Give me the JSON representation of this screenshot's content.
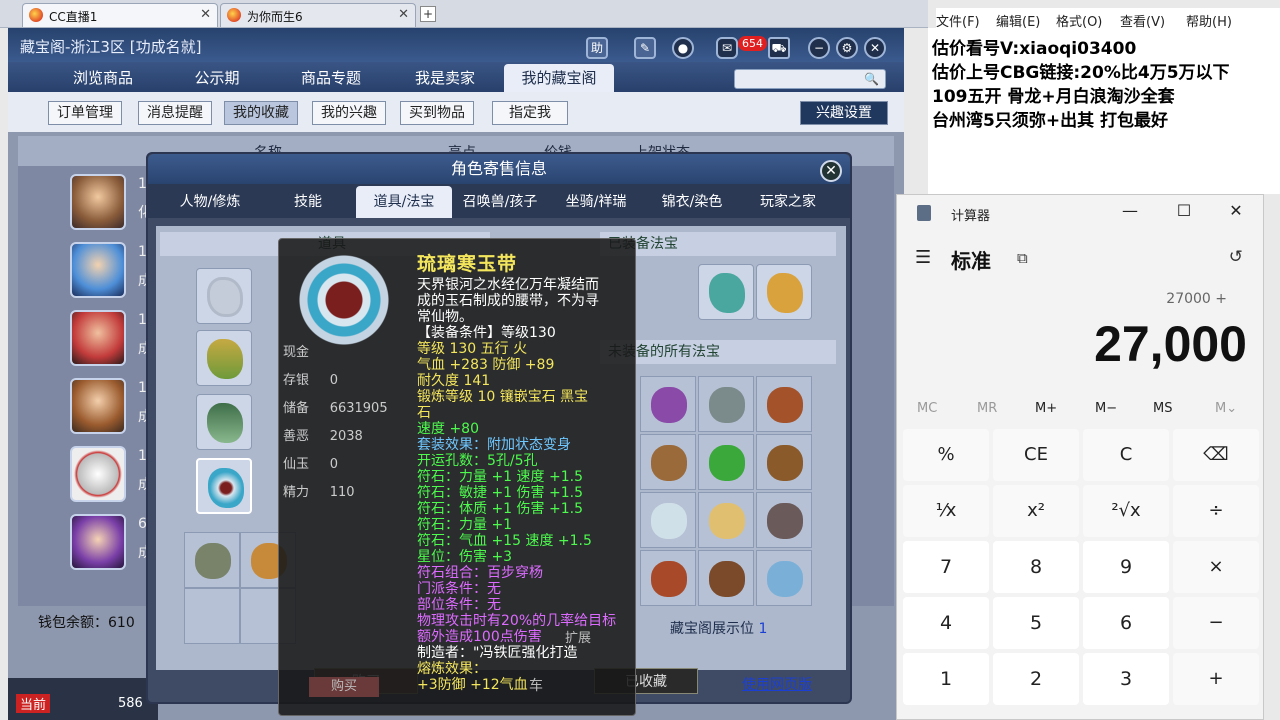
{
  "browser": {
    "tabs": [
      {
        "label": "CC直播1"
      },
      {
        "label": "为你而生6"
      }
    ],
    "new_tab": "+"
  },
  "game": {
    "title": "藏宝阁-浙江3区 [功成名就]",
    "title_buttons": {
      "help": "助",
      "badge": "654"
    },
    "nav_tabs": [
      "浏览商品",
      "公示期",
      "商品专题",
      "我是卖家",
      "我的藏宝阁"
    ],
    "active_nav": "我的藏宝阁",
    "subnav": [
      "订单管理",
      "消息提醒",
      "我的收藏",
      "我的兴趣",
      "买到物品",
      "指定我"
    ],
    "active_subnav": "我的收藏",
    "interest_settings": "兴趣设置",
    "list_headers": {
      "name": "名称",
      "price": "价钱",
      "status": "上架状态",
      "bright": "亮点"
    },
    "rows": [
      {
        "lvl": "17",
        "sub": "化"
      },
      {
        "lvl": "10",
        "sub": "成"
      },
      {
        "lvl": "13",
        "sub": "成"
      },
      {
        "lvl": "10",
        "sub": "成"
      },
      {
        "lvl": "13",
        "sub": "成"
      },
      {
        "lvl": "69",
        "sub": "成"
      }
    ],
    "wallet": "钱包余额：610",
    "current": "当前",
    "counter": "586"
  },
  "modal": {
    "title": "角色寄售信息",
    "tabs": [
      "人物/修炼",
      "技能",
      "道具/法宝",
      "召唤兽/孩子",
      "坐骑/祥瑞",
      "锦衣/染色",
      "玩家之家"
    ],
    "active_tab": "道具/法宝",
    "section_items": "道具",
    "section_equipped": "已装备法宝",
    "section_unequipped": "未装备的所有法宝",
    "stats": [
      {
        "label": "现金",
        "value": ""
      },
      {
        "label": "存银",
        "value": "0"
      },
      {
        "label": "储备",
        "value": "6631905"
      },
      {
        "label": "善恶",
        "value": "2038"
      },
      {
        "label": "仙玉",
        "value": "0"
      },
      {
        "label": "精力",
        "value": "110"
      }
    ],
    "showcase": "藏宝阁展示位",
    "showcase_count": "1",
    "buy": "购买",
    "cart": "车",
    "collected": "已收藏",
    "web_version": "使用网页版",
    "expand": "扩展"
  },
  "tooltip": {
    "title": "琉璃寒玉带",
    "lines": [
      {
        "text": "天界银河之水经亿万年凝结而",
        "c": "tw"
      },
      {
        "text": "成的玉石制成的腰带，不为寻",
        "c": "tw"
      },
      {
        "text": "常仙物。",
        "c": "tw"
      },
      {
        "text": "【装备条件】等级130",
        "c": "tw"
      },
      {
        "text": "等级 130  五行 火",
        "c": "ty"
      },
      {
        "text": "气血 +283 防御 +89",
        "c": "ty"
      },
      {
        "text": "耐久度 141",
        "c": "ty"
      },
      {
        "text": "锻炼等级 10  镶嵌宝石 黑宝",
        "c": "ty"
      },
      {
        "text": "石",
        "c": "ty"
      },
      {
        "text": "速度 +80",
        "c": "tg"
      },
      {
        "text": "套装效果：附加状态变身",
        "c": "tb"
      },
      {
        "text": "开运孔数：5孔/5孔",
        "c": "tg"
      },
      {
        "text": "符石：力量 +1  速度 +1.5",
        "c": "tg"
      },
      {
        "text": "符石：敏捷 +1  伤害 +1.5",
        "c": "tg"
      },
      {
        "text": "符石：体质 +1  伤害 +1.5",
        "c": "tg"
      },
      {
        "text": "符石：力量 +1",
        "c": "tg"
      },
      {
        "text": "符石：气血 +15  速度 +1.5",
        "c": "tg"
      },
      {
        "text": "星位：伤害 +3",
        "c": "tg"
      },
      {
        "text": "符石组合：百步穿杨",
        "c": "tp"
      },
      {
        "text": "门派条件：无",
        "c": "tp"
      },
      {
        "text": "部位条件：无",
        "c": "tp"
      },
      {
        "text": "物理攻击时有20%的几率给目标",
        "c": "tp"
      },
      {
        "text": "额外造成100点伤害",
        "c": "tp"
      },
      {
        "text": "制造者：\"冯铁匠强化打造",
        "c": "tw"
      },
      {
        "text": "熔炼效果：",
        "c": "ty"
      },
      {
        "text": "+3防御 +12气血",
        "c": "ty"
      }
    ]
  },
  "notepad": {
    "menu": [
      "文件(F)",
      "编辑(E)",
      "格式(O)",
      "查看(V)",
      "帮助(H)"
    ],
    "lines": [
      "估价看号V:xiaoqi03400",
      "估价上号CBG链接:20%比4万5万以下",
      "109五开 骨龙+月白浪淘沙全套",
      "台州湾5只须弥+出其 打包最好"
    ]
  },
  "calculator": {
    "title": "计算器",
    "mode": "标准",
    "expression": "27000 +",
    "display": "27,000",
    "memory": [
      "MC",
      "MR",
      "M+",
      "M−",
      "MS",
      "M⌄"
    ],
    "keys": [
      [
        "%",
        "CE",
        "C",
        "⌫"
      ],
      [
        "¹⁄x",
        "x²",
        "²√x",
        "÷"
      ],
      [
        "7",
        "8",
        "9",
        "×"
      ],
      [
        "4",
        "5",
        "6",
        "−"
      ],
      [
        "1",
        "2",
        "3",
        "+"
      ]
    ]
  }
}
